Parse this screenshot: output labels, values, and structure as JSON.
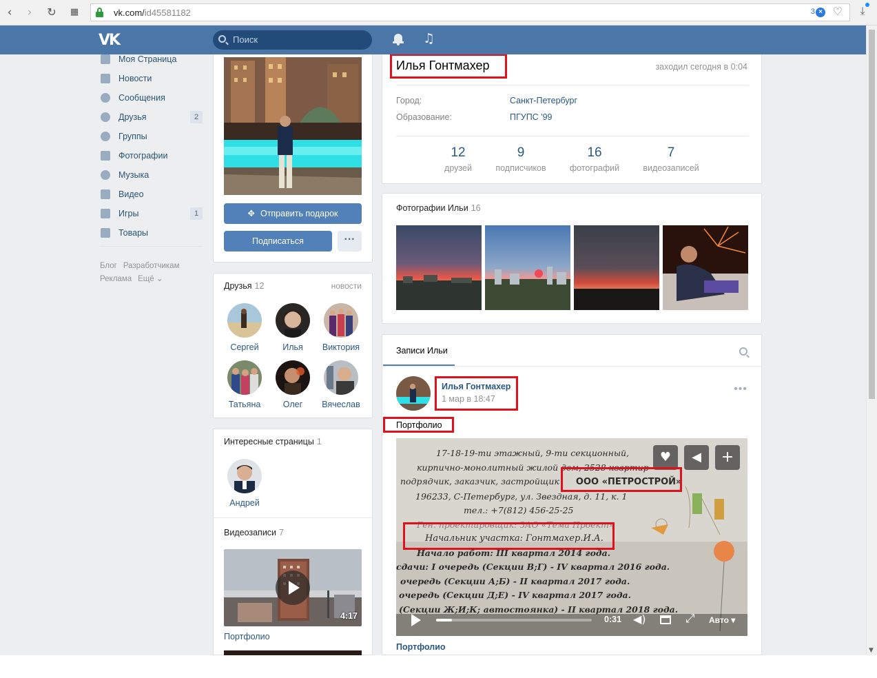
{
  "browser": {
    "url_host": "vk.com/",
    "url_path": "id45581182",
    "ext_count": "3",
    "ext_icon_glyph": "×"
  },
  "header": {
    "logo": "VK",
    "search_placeholder": "Поиск"
  },
  "left_menu": {
    "items": [
      {
        "label": "Моя Страница",
        "icon": "home-icon",
        "badge": ""
      },
      {
        "label": "Новости",
        "icon": "news-icon",
        "badge": ""
      },
      {
        "label": "Сообщения",
        "icon": "message-icon",
        "badge": ""
      },
      {
        "label": "Друзья",
        "icon": "friend-icon",
        "badge": "2"
      },
      {
        "label": "Группы",
        "icon": "group-icon",
        "badge": ""
      },
      {
        "label": "Фотографии",
        "icon": "camera-icon",
        "badge": ""
      },
      {
        "label": "Музыка",
        "icon": "music-icon",
        "badge": ""
      },
      {
        "label": "Видео",
        "icon": "video-icon",
        "badge": ""
      },
      {
        "label": "Игры",
        "icon": "gamepad-icon",
        "badge": "1"
      },
      {
        "label": "Товары",
        "icon": "bag-icon",
        "badge": ""
      }
    ],
    "footer": {
      "blog": "Блог",
      "developers": "Разработчикам",
      "ads": "Реклама",
      "more": "Ещё ⌄"
    }
  },
  "profile": {
    "name": "Илья Гонтмахер",
    "last_seen": "заходил сегодня в 0:04",
    "city_label": "Город:",
    "city": "Санкт-Петербург",
    "edu_label": "Образование:",
    "edu": "ПГУПС '99",
    "send_gift": "Отправить подарок",
    "subscribe": "Подписаться",
    "more_dots": "···",
    "stats": [
      {
        "num": "12",
        "label": "друзей"
      },
      {
        "num": "9",
        "label": "подписчиков"
      },
      {
        "num": "16",
        "label": "фотографий"
      },
      {
        "num": "7",
        "label": "видеозаписей"
      }
    ]
  },
  "friends": {
    "title": "Друзья",
    "count": "12",
    "news_link": "новости",
    "list": [
      "Сергей",
      "Илья",
      "Виктория",
      "Татьяна",
      "Олег",
      "Вячеслав"
    ]
  },
  "pages": {
    "title": "Интересные страницы",
    "count": "1",
    "list": [
      "Андрей"
    ]
  },
  "videos": {
    "title": "Видеозаписи",
    "count": "7",
    "first_duration": "4:17",
    "first_title": "Портфолио"
  },
  "photos": {
    "title": "Фотографии Ильи",
    "count": "16"
  },
  "wall": {
    "tab": "Записи Ильи",
    "post": {
      "author": "Илья Гонтмахер",
      "date": "1 мар в 18:47",
      "text": "Портфолио",
      "video_time": "0:31",
      "video_quality": "Авто ▾",
      "video_caption": "Портфолио",
      "video_progress": 0.1,
      "video_volume": 0.6,
      "sign_lines": [
        "17-18-19-ти этажный, 9-ти секционный,",
        "кирпично-монолитный жилой дом, 2528 квартир",
        "подрядчик, заказчик, застройщик",
        "ООО «ПЕТРОСТРОЙ»",
        "196233, С-Петербург, ул. Звездная, д. 11, к. 1",
        "тел.: +7(812) 456-25-25",
        "Ген. проектировщик: ЗАО «Тема Проект»",
        "Начальник участка: Гонтмахер.И.А.",
        "Начало работ: III квартал 2014 года.",
        "сдачи: I очередь (Секции В;Г) - IV квартал 2016 года.",
        "очередь (Секции А;Б) - II квартал 2017 года.",
        "очередь (Секции Д;Е) - IV квартал 2017 года.",
        "(Секции Ж;И;К; автостоянка) - II квартал 2018 года."
      ]
    }
  },
  "colors": {
    "brand": "#4a76a8",
    "button": "#5181b8",
    "link": "#2a5885",
    "annotation": "#e0101d"
  }
}
